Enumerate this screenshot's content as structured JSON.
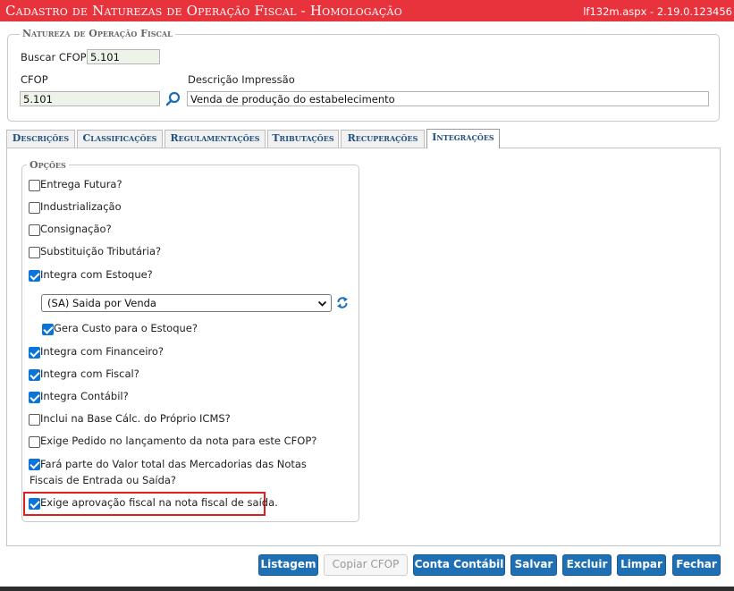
{
  "title": "Cadastro de Naturezas de Operação Fiscal  - Homologação",
  "version": "lf132m.aspx - 2.19.0.123456",
  "fieldset_nat": {
    "legend": "Natureza de Operação Fiscal",
    "buscar_label": "Buscar CFOP:",
    "buscar_value": "5.101",
    "cfop_label": "CFOP",
    "cfop_value": "5.101",
    "descricao_label": "Descrição Impressão",
    "descricao_value": "Venda de produção do estabelecimento"
  },
  "tabs": [
    {
      "label": "Descrições",
      "active": false
    },
    {
      "label": "Classificações",
      "active": false
    },
    {
      "label": "Regulamentações",
      "active": false
    },
    {
      "label": "Tributações",
      "active": false
    },
    {
      "label": "Recuperações",
      "active": false
    },
    {
      "label": "Integrações",
      "active": true
    }
  ],
  "opcoes": {
    "legend": "Opções",
    "items": [
      {
        "label": "Entrega Futura?",
        "checked": false
      },
      {
        "label": "Industrialização",
        "checked": false
      },
      {
        "label": "Consignação?",
        "checked": false
      },
      {
        "label": "Substituição Tributária?",
        "checked": false
      },
      {
        "label": "Integra com Estoque?",
        "checked": true
      },
      {
        "label": "Gera Custo para o Estoque?",
        "checked": true
      },
      {
        "label": "Integra com Financeiro?",
        "checked": true
      },
      {
        "label": "Integra com Fiscal?",
        "checked": true
      },
      {
        "label": "Integra Contábil?",
        "checked": true
      },
      {
        "label": "Inclui na Base Cálc. do Próprio ICMS?",
        "checked": false
      },
      {
        "label": "Exige Pedido no lançamento da nota para este CFOP?",
        "checked": false
      },
      {
        "label": "Fará parte do Valor total das Mercadorias das Notas Fiscais de Entrada ou Saída?",
        "checked": true
      },
      {
        "label": "Exige aprovação fiscal na nota fiscal de saída.",
        "checked": true
      }
    ],
    "estoque_select": "(SA) Saida por Venda"
  },
  "buttons": {
    "listagem": "Listagem",
    "copiar": "Copiar CFOP",
    "contabil": "Conta Contábil",
    "salvar": "Salvar",
    "excluir": "Excluir",
    "limpar": "Limpar",
    "fechar": "Fechar"
  },
  "colors": {
    "title_bar": "#e8323c",
    "button": "#1f6fb5",
    "tab_text": "#20507d",
    "highlight": "#e01e1e",
    "checkbox": "#0b74d8"
  },
  "icons": [
    "search-icon",
    "refresh-icon",
    "chevron-down-icon"
  ]
}
